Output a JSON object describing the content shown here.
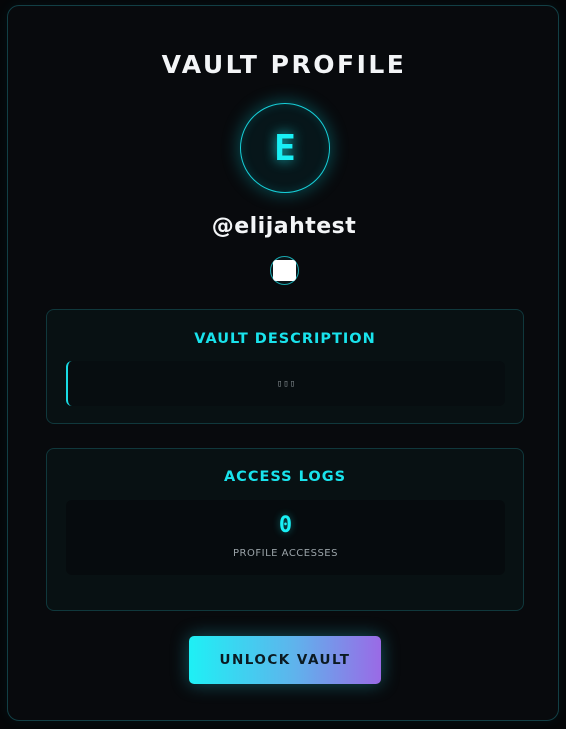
{
  "profile": {
    "title": "VAULT PROFILE",
    "avatar_letter": "E",
    "username": "@elijahtest"
  },
  "description": {
    "heading": "VAULT DESCRIPTION",
    "text": "▯▯▯"
  },
  "access_logs": {
    "heading": "ACCESS LOGS",
    "count": "0",
    "count_label": "PROFILE ACCESSES"
  },
  "actions": {
    "unlock_label": "UNLOCK VAULT"
  },
  "colors": {
    "accent": "#19f0f5",
    "background": "#050608",
    "gradient_start": "#1ef0f5",
    "gradient_end": "#9a6ae6"
  }
}
